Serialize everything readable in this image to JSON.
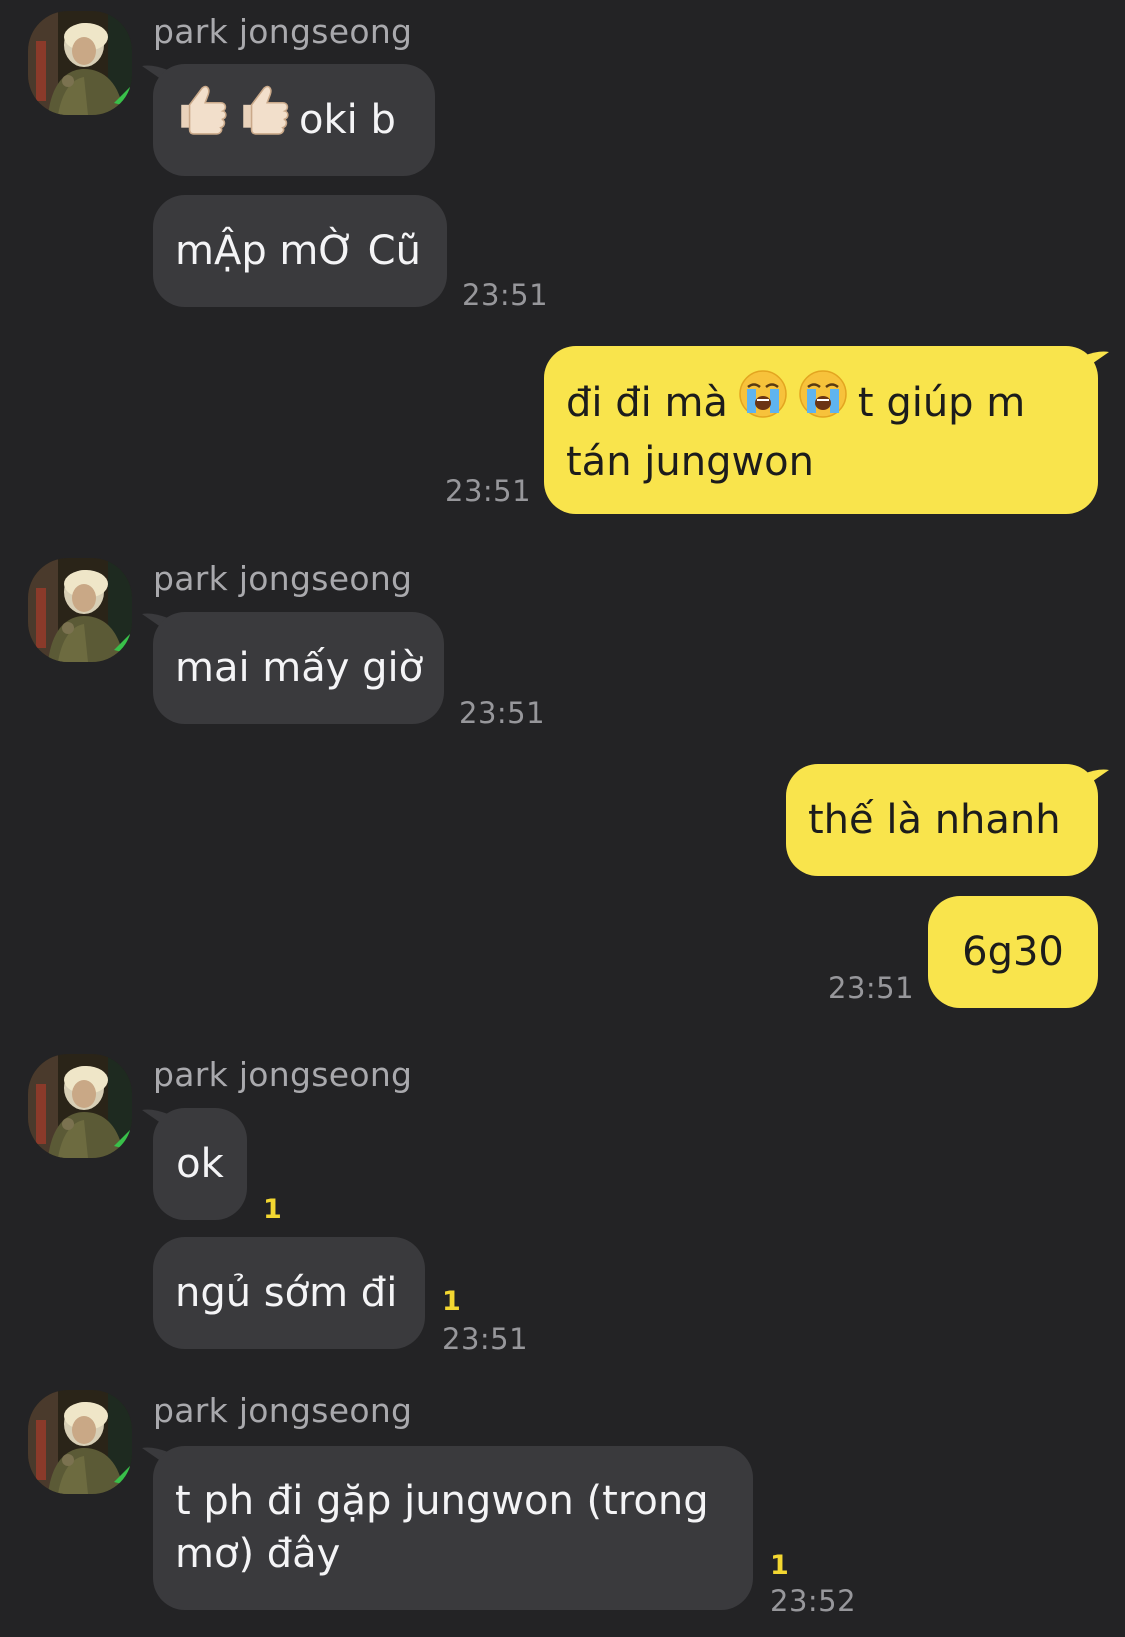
{
  "contact": {
    "name": "park jongseong"
  },
  "messages": [
    {
      "from": "them",
      "text": "oki b",
      "emoji_prefix": [
        "thumbs-up",
        "thumbs-up"
      ]
    },
    {
      "from": "them",
      "text": "mẬp mỜ Cũ",
      "time": "23:51"
    },
    {
      "from": "me",
      "line1_before": "đi đi mà",
      "line1_after": "t giúp m",
      "line2": "tán jungwon",
      "emoji": [
        "crying-face",
        "crying-face"
      ],
      "time": "23:51"
    },
    {
      "from": "them",
      "text": "mai mấy giờ",
      "time": "23:51"
    },
    {
      "from": "me",
      "text": "thế là nhanh"
    },
    {
      "from": "me",
      "text": "6g30",
      "time": "23:51"
    },
    {
      "from": "them",
      "text": "ok",
      "unread": "1"
    },
    {
      "from": "them",
      "text": "ngủ sớm đi",
      "unread": "1",
      "time": "23:51"
    },
    {
      "from": "them",
      "line1": "t ph đi gặp jungwon (trong",
      "line2": "mơ) đây",
      "unread": "1",
      "time": "23:52"
    }
  ],
  "colors": {
    "background": "#232325",
    "incoming_bubble": "#3a3a3d",
    "outgoing_bubble": "#f9e44c",
    "unread_counter": "#f3d731"
  }
}
